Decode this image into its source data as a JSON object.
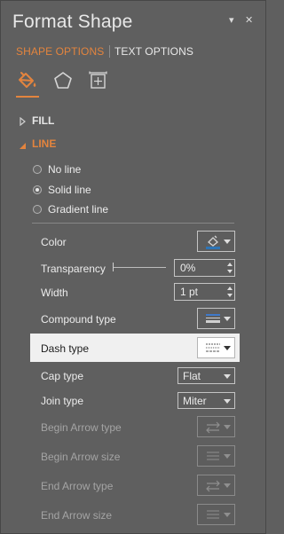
{
  "header": {
    "title": "Format Shape",
    "dropdown_glyph": "▾",
    "close_glyph": "✕"
  },
  "tabs": [
    {
      "label": "SHAPE OPTIONS",
      "active": true
    },
    {
      "label": "TEXT OPTIONS",
      "active": false
    }
  ],
  "category_icons": [
    "fill-line-icon",
    "effects-pentagon-icon",
    "size-properties-icon"
  ],
  "sections": {
    "fill": {
      "label": "FILL",
      "expanded": false
    },
    "line": {
      "label": "LINE",
      "expanded": true
    }
  },
  "line_options": [
    {
      "label": "No line",
      "checked": false
    },
    {
      "label": "Solid line",
      "checked": true
    },
    {
      "label": "Gradient line",
      "checked": false
    }
  ],
  "properties": {
    "color": {
      "label": "Color"
    },
    "transparency": {
      "label": "Transparency",
      "value": "0%"
    },
    "width": {
      "label": "Width",
      "value": "1 pt"
    },
    "compound_type": {
      "label": "Compound type"
    },
    "dash_type": {
      "label": "Dash type"
    },
    "cap_type": {
      "label": "Cap type",
      "value": "Flat"
    },
    "join_type": {
      "label": "Join type",
      "value": "Miter"
    },
    "begin_arrow_type": {
      "label": "Begin Arrow type"
    },
    "begin_arrow_size": {
      "label": "Begin Arrow size"
    },
    "end_arrow_type": {
      "label": "End Arrow type"
    },
    "end_arrow_size": {
      "label": "End Arrow size"
    }
  },
  "colors": {
    "accent": "#e3843e",
    "panel_bg": "#5f5f5f",
    "highlight_row": "#f0f0f0",
    "line_color_swatch": "#2e75b6"
  }
}
